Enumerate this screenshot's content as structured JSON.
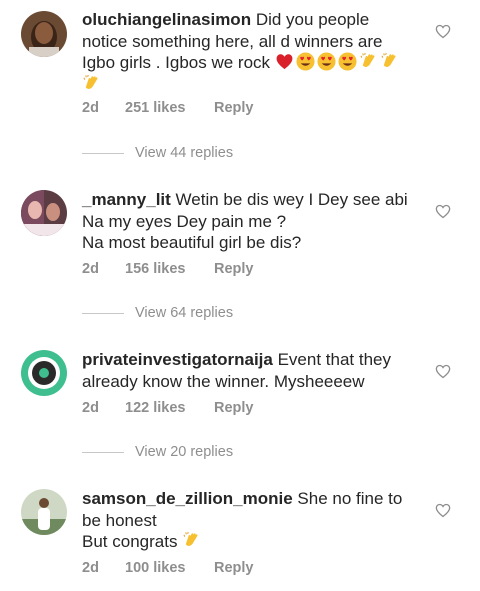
{
  "comments": [
    {
      "username": "oluchiangelinasimon",
      "text": "Did you people notice something here, all d winners are Igbo girls . Igbos we rock",
      "emoji": [
        "red-heart",
        "heart-eyes",
        "heart-eyes",
        "heart-eyes",
        "clapping-hands",
        "clapping-hands",
        "clapping-hands"
      ],
      "age": "2d",
      "likes": "251 likes",
      "reply": "Reply",
      "view_replies": "View 44 replies"
    },
    {
      "username": "_manny_lit",
      "text_lines": [
        "Wetin be dis wey I Dey see abi",
        "Na my eyes Dey pain me ?",
        "Na most beautiful girl be dis?"
      ],
      "age": "2d",
      "likes": "156 likes",
      "reply": "Reply",
      "view_replies": "View 64 replies"
    },
    {
      "username": "privateinvestigatornaija",
      "text": "Event that they already know the winner.  Mysheeeew",
      "age": "2d",
      "likes": "122 likes",
      "reply": "Reply",
      "view_replies": "View 20 replies"
    },
    {
      "username": "samson_de_zillion_monie",
      "text": "She no fine to be honest",
      "text2": "But congrats",
      "emoji": [
        "clapping-hands"
      ],
      "age": "2d",
      "likes": "100 likes",
      "reply": "Reply"
    }
  ],
  "colors": {
    "text": "#262626",
    "secondary": "#8e8e8e",
    "divider": "#c7c7c7"
  },
  "icons": {
    "like": "heart-outline-icon"
  }
}
